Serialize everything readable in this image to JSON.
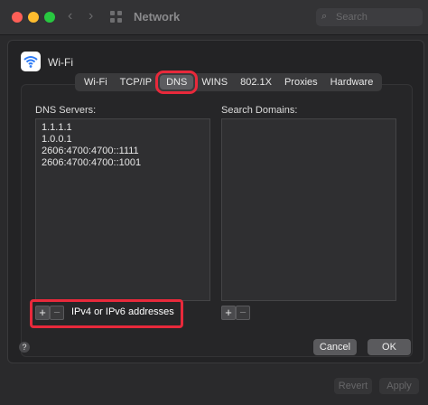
{
  "window": {
    "title": "Network",
    "search_placeholder": "Search"
  },
  "sheet": {
    "service_name": "Wi-Fi",
    "tabs": [
      {
        "label": "Wi-Fi"
      },
      {
        "label": "TCP/IP"
      },
      {
        "label": "DNS",
        "selected": true
      },
      {
        "label": "WINS"
      },
      {
        "label": "802.1X"
      },
      {
        "label": "Proxies"
      },
      {
        "label": "Hardware"
      }
    ],
    "dns_servers_label": "DNS Servers:",
    "dns_servers": [
      "1.1.1.1",
      "1.0.0.1",
      "2606:4700:4700::1111",
      "2606:4700:4700::1001"
    ],
    "search_domains_label": "Search Domains:",
    "add_symbol": "+",
    "remove_symbol": "−",
    "address_hint": "IPv4 or IPv6 addresses",
    "help_symbol": "?",
    "cancel_label": "Cancel",
    "ok_label": "OK"
  },
  "footer": {
    "revert_label": "Revert",
    "apply_label": "Apply"
  },
  "colors": {
    "highlight": "#e8293b",
    "background": "#2a2a2c"
  },
  "icons": {
    "back": "chevron-left-icon",
    "forward": "chevron-right-icon",
    "grid": "grid-icon",
    "search": "search-icon",
    "wifi": "wifi-icon"
  }
}
